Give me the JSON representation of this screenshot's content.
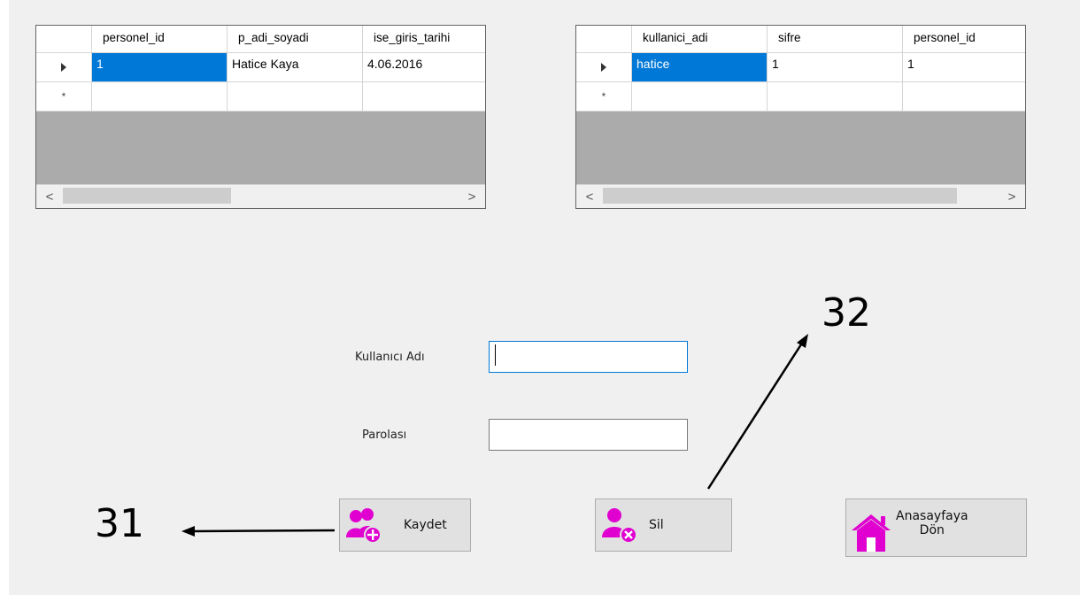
{
  "personel_grid": {
    "columns": [
      "personel_id",
      "p_adi_soyadi",
      "ise_giris_tarihi"
    ],
    "rows": [
      [
        "1",
        "Hatice Kaya",
        "4.06.2016"
      ]
    ],
    "new_row_marker": "*",
    "scroll_left": "<",
    "scroll_right": ">"
  },
  "kullanici_grid": {
    "columns": [
      "kullanici_adi",
      "sifre",
      "personel_id"
    ],
    "rows": [
      [
        "hatice",
        "1",
        "1"
      ]
    ],
    "new_row_marker": "*",
    "scroll_left": "<",
    "scroll_right": ">"
  },
  "form": {
    "username_label": "Kullanıcı Adı",
    "username_value": "",
    "password_label": "Parolası",
    "password_value": ""
  },
  "buttons": {
    "save_label": "Kaydet",
    "delete_label": "Sil",
    "home_label_line1": "Anasayfaya",
    "home_label_line2": "Dön"
  },
  "annotations": {
    "save_callout": "31",
    "delete_callout": "32"
  },
  "colors": {
    "selection": "#0078d7",
    "icon_magenta": "#e000d0",
    "grid_empty": "#ababab"
  }
}
